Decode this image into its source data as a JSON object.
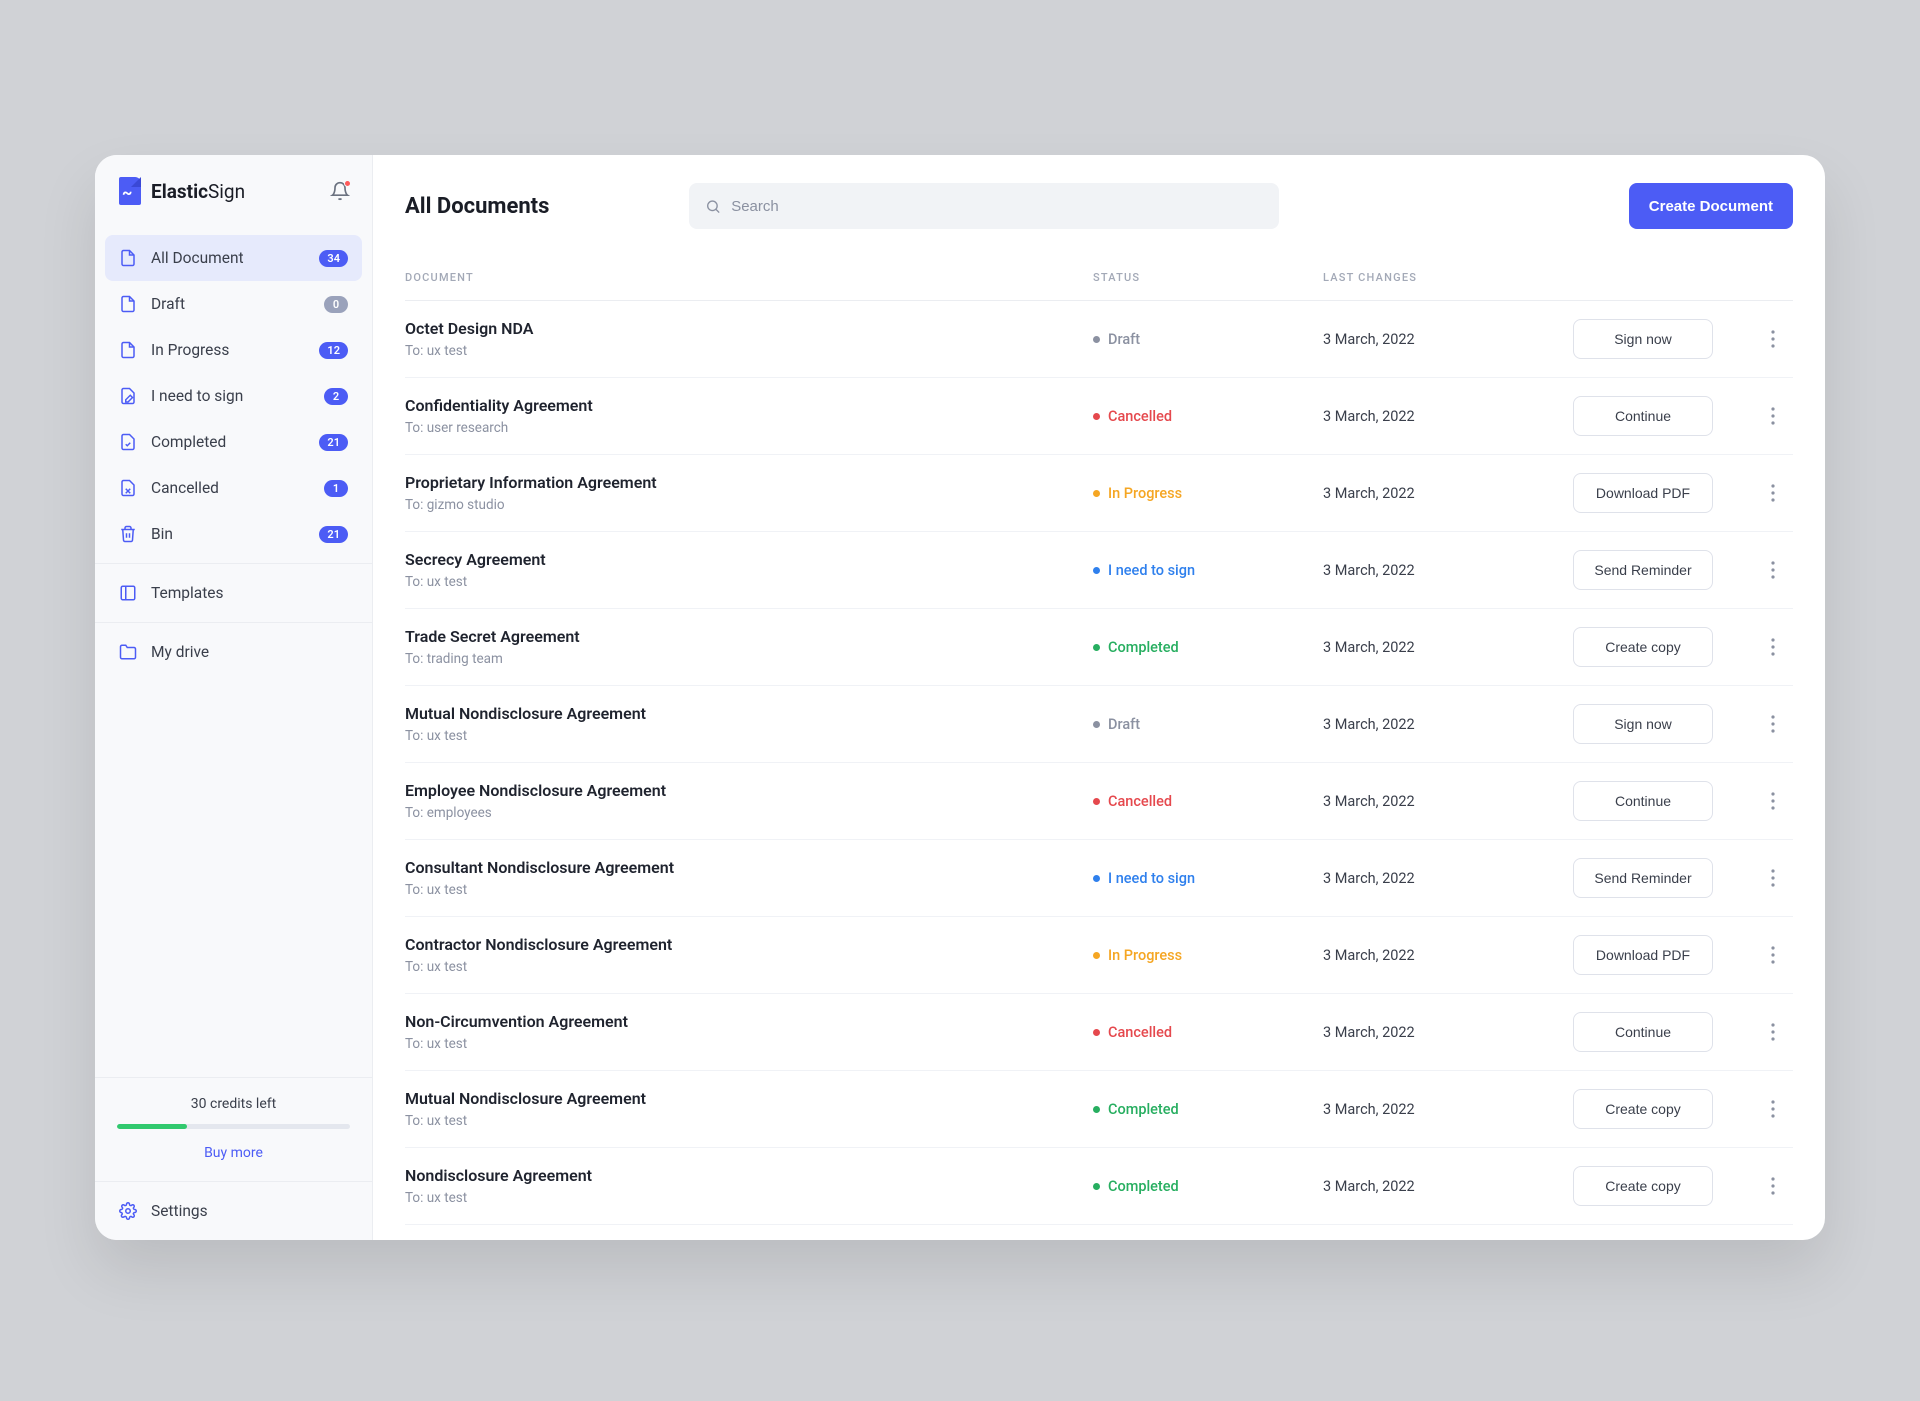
{
  "brand": {
    "name_bold": "Elastic",
    "name_light": "Sign"
  },
  "header": {
    "page_title": "All Documents",
    "search_placeholder": "Search",
    "create_button": "Create Document"
  },
  "sidebar": {
    "items": [
      {
        "label": "All Document",
        "badge": "34",
        "icon": "document",
        "active": true
      },
      {
        "label": "Draft",
        "badge": "0",
        "icon": "document",
        "badge_muted": true
      },
      {
        "label": "In Progress",
        "badge": "12",
        "icon": "document"
      },
      {
        "label": "I need to sign",
        "badge": "2",
        "icon": "pen-doc"
      },
      {
        "label": "Completed",
        "badge": "21",
        "icon": "doc-check"
      },
      {
        "label": "Cancelled",
        "badge": "1",
        "icon": "doc-x"
      },
      {
        "label": "Bin",
        "badge": "21",
        "icon": "trash"
      }
    ],
    "secondary": [
      {
        "label": "Templates",
        "icon": "template"
      },
      {
        "label": "My drive",
        "icon": "folder"
      }
    ]
  },
  "credits": {
    "text": "30 credits left",
    "buy_more": "Buy more",
    "percent": 30
  },
  "settings_label": "Settings",
  "table": {
    "columns": {
      "document": "DOCUMENT",
      "status": "STATUS",
      "last_changes": "LAST CHANGES"
    },
    "status_palette": {
      "Draft": "#8b91a1",
      "Cancelled": "#e5484d",
      "In Progress": "#f5a623",
      "I need to sign": "#2f80ed",
      "I need to  sign": "#2f80ed",
      "Completed": "#27ae60"
    },
    "rows": [
      {
        "title": "Octet Design NDA",
        "to": "To: ux test",
        "status": "Draft",
        "date": "3 March, 2022",
        "action": "Sign now"
      },
      {
        "title": "Confidentiality Agreement",
        "to": "To: user research",
        "status": "Cancelled",
        "date": "3 March, 2022",
        "action": "Continue"
      },
      {
        "title": "Proprietary Information Agreement",
        "to": "To: gizmo studio",
        "status": "In Progress",
        "date": "3 March, 2022",
        "action": "Download PDF"
      },
      {
        "title": "Secrecy Agreement",
        "to": "To: ux test",
        "status": "I need to  sign",
        "date": "3 March, 2022",
        "action": "Send Reminder"
      },
      {
        "title": "Trade Secret Agreement",
        "to": "To: trading team",
        "status": "Completed",
        "date": "3 March, 2022",
        "action": "Create copy"
      },
      {
        "title": "Mutual Nondisclosure Agreement",
        "to": "To: ux test",
        "status": "Draft",
        "date": "3 March, 2022",
        "action": "Sign now"
      },
      {
        "title": "Employee Nondisclosure Agreement",
        "to": "To: employees",
        "status": "Cancelled",
        "date": "3 March, 2022",
        "action": "Continue"
      },
      {
        "title": "Consultant Nondisclosure Agreement",
        "to": "To: ux test",
        "status": "I need to sign",
        "date": "3 March, 2022",
        "action": "Send Reminder"
      },
      {
        "title": "Contractor Nondisclosure Agreement",
        "to": "To: ux test",
        "status": "In Progress",
        "date": "3 March, 2022",
        "action": "Download PDF"
      },
      {
        "title": "Non-Circumvention Agreement",
        "to": "To: ux test",
        "status": "Cancelled",
        "date": "3 March, 2022",
        "action": "Continue"
      },
      {
        "title": "Mutual Nondisclosure Agreement",
        "to": "To: ux test",
        "status": "Completed",
        "date": "3 March, 2022",
        "action": "Create copy"
      },
      {
        "title": "Nondisclosure Agreement",
        "to": "To: ux test",
        "status": "Completed",
        "date": "3 March, 2022",
        "action": "Create copy"
      }
    ]
  }
}
